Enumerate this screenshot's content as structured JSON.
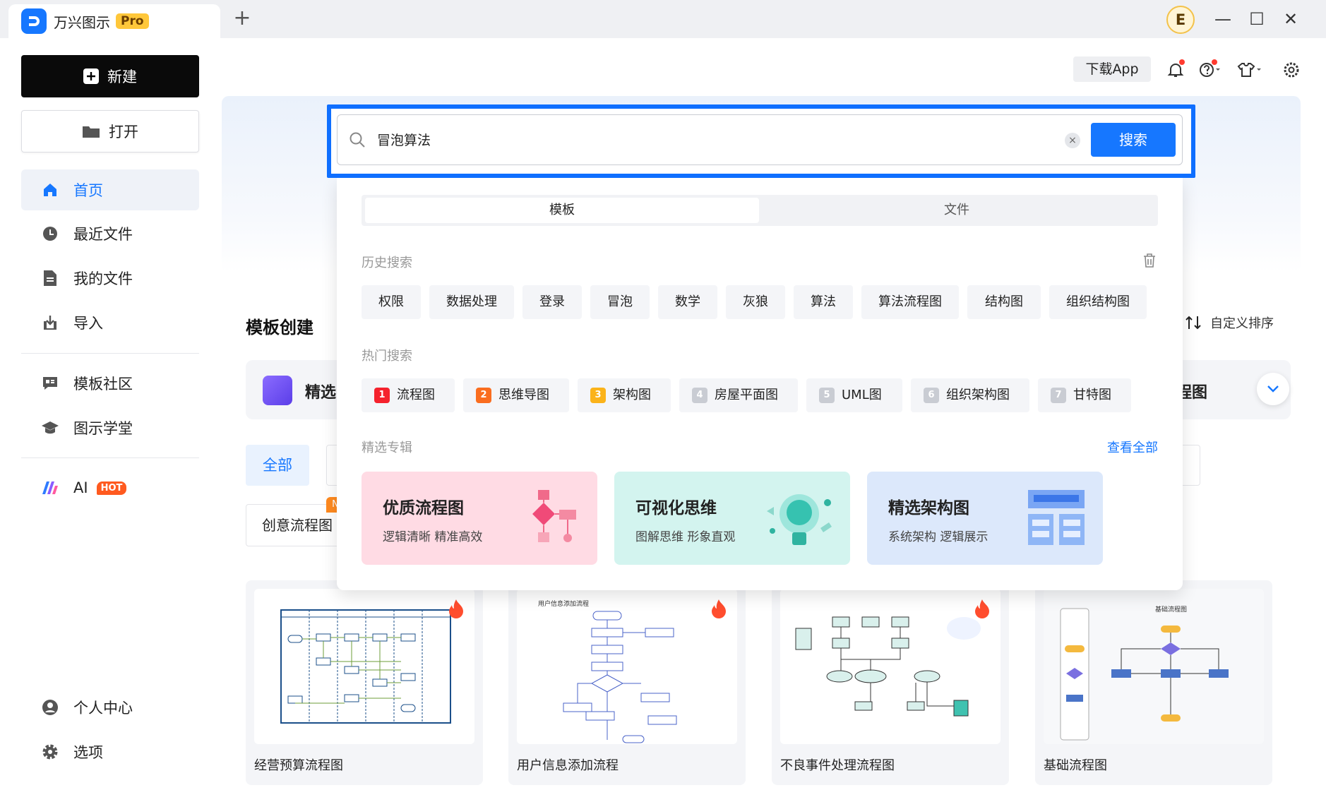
{
  "app": {
    "name": "万兴图示",
    "badge": "Pro",
    "avatar_letter": "E"
  },
  "window": {
    "new_tab": "+",
    "minimize": "—",
    "maximize": "☐",
    "close": "✕"
  },
  "sidebar": {
    "new_label": "新建",
    "open_label": "打开",
    "items": [
      {
        "label": "首页",
        "icon": "home-icon",
        "active": true
      },
      {
        "label": "最近文件",
        "icon": "clock-icon"
      },
      {
        "label": "我的文件",
        "icon": "file-icon"
      },
      {
        "label": "导入",
        "icon": "import-icon"
      },
      {
        "label": "模板社区",
        "icon": "community-icon"
      },
      {
        "label": "图示学堂",
        "icon": "graduation-cap-icon"
      }
    ],
    "ai": {
      "label": "AI",
      "badge": "HOT"
    },
    "bottom": [
      {
        "label": "个人中心",
        "icon": "user-icon"
      },
      {
        "label": "选项",
        "icon": "gear-icon"
      }
    ]
  },
  "header": {
    "download_app": "下载App"
  },
  "main": {
    "section_title": "模板创建",
    "sort_label": "自定义排序",
    "selected_label": "精选",
    "flowchart_label": "程图",
    "filter_all": "全部",
    "chip_creative": "创意流程图",
    "chip_badge": "N",
    "cards": [
      {
        "label": "经营预算流程图"
      },
      {
        "label": "用户信息添加流程",
        "thumb_title": "用户信息添加流程"
      },
      {
        "label": "不良事件处理流程图"
      },
      {
        "label": "基础流程图",
        "thumb_title": "基础流程图"
      }
    ]
  },
  "search": {
    "value": "冒泡算法",
    "clear": "×",
    "button": "搜索",
    "tabs": [
      "模板",
      "文件"
    ],
    "history_title": "历史搜索",
    "history": [
      "权限",
      "数据处理",
      "登录",
      "冒泡",
      "数学",
      "灰狼",
      "算法",
      "算法流程图",
      "结构图",
      "组织结构图"
    ],
    "hot_title": "热门搜索",
    "hot": [
      {
        "rank": "1",
        "label": "流程图",
        "color": "#f5222d"
      },
      {
        "rank": "2",
        "label": "思维导图",
        "color": "#fa6d1f"
      },
      {
        "rank": "3",
        "label": "架构图",
        "color": "#fbb31a"
      },
      {
        "rank": "4",
        "label": "房屋平面图",
        "color": "#c9ccd3"
      },
      {
        "rank": "5",
        "label": "UML图",
        "color": "#c9ccd3"
      },
      {
        "rank": "6",
        "label": "组织架构图",
        "color": "#c9ccd3"
      },
      {
        "rank": "7",
        "label": "甘特图",
        "color": "#c9ccd3"
      }
    ],
    "album_title": "精选专辑",
    "view_all": "查看全部",
    "albums": [
      {
        "title": "优质流程图",
        "subtitle": "逻辑清晰 精准高效",
        "bg": "#ffdbe4"
      },
      {
        "title": "可视化思维",
        "subtitle": "图解思维 形象直观",
        "bg": "#d3f4ef"
      },
      {
        "title": "精选架构图",
        "subtitle": "系统架构 逻辑展示",
        "bg": "#dce8fb"
      }
    ]
  },
  "colors": {
    "accent": "#1677ff",
    "hot": "#ff5a1f"
  }
}
